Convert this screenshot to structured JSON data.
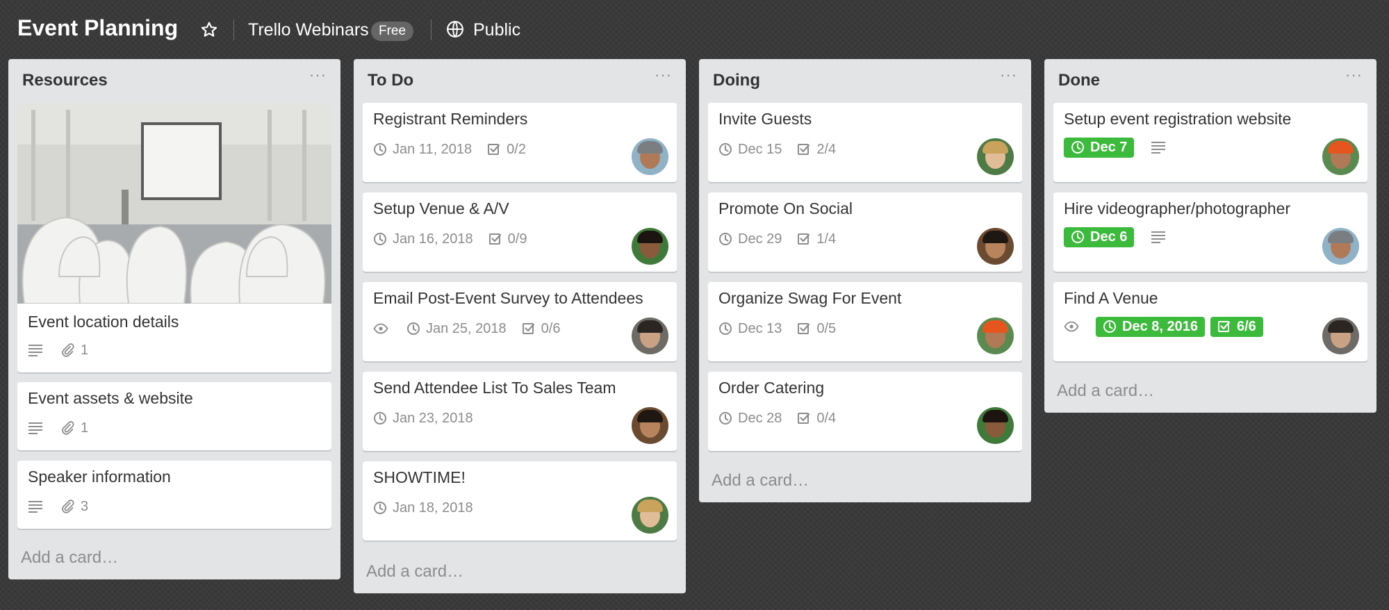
{
  "header": {
    "title": "Event Planning",
    "team": "Trello Webinars",
    "plan_badge": "Free",
    "visibility": "Public"
  },
  "colors": {
    "accent_green": "#3cba3c",
    "list_bg": "#e2e4e6"
  },
  "lists": [
    {
      "title": "Resources",
      "menu": "···",
      "add_card": "Add a card…",
      "cards": [
        {
          "title": "Event location details",
          "attachments": "1"
        },
        {
          "title": "Event assets & website",
          "attachments": "1"
        },
        {
          "title": "Speaker information",
          "attachments": "3"
        }
      ]
    },
    {
      "title": "To Do",
      "menu": "···",
      "add_card": "Add a card…",
      "cards": [
        {
          "title": "Registrant Reminders",
          "due": "Jan 11, 2018",
          "checklist": "0/2"
        },
        {
          "title": "Setup Venue & A/V",
          "due": "Jan 16, 2018",
          "checklist": "0/9"
        },
        {
          "title": "Email Post-Event Survey to Attendees",
          "due": "Jan 25, 2018",
          "checklist": "0/6"
        },
        {
          "title": "Send Attendee List To Sales Team",
          "due": "Jan 23, 2018"
        },
        {
          "title": "SHOWTIME!",
          "due": "Jan 18, 2018"
        }
      ]
    },
    {
      "title": "Doing",
      "menu": "···",
      "add_card": "Add a card…",
      "cards": [
        {
          "title": "Invite Guests",
          "due": "Dec 15",
          "checklist": "2/4"
        },
        {
          "title": "Promote On Social",
          "due": "Dec 29",
          "checklist": "1/4"
        },
        {
          "title": "Organize Swag For Event",
          "due": "Dec 13",
          "checklist": "0/5"
        },
        {
          "title": "Order Catering",
          "due": "Dec 28",
          "checklist": "0/4"
        }
      ]
    },
    {
      "title": "Done",
      "menu": "···",
      "add_card": "Add a card…",
      "cards": [
        {
          "title": "Setup event registration website",
          "due": "Dec 7"
        },
        {
          "title": "Hire videographer/photographer",
          "due": "Dec 6"
        },
        {
          "title": "Find A Venue",
          "due": "Dec 8, 2016",
          "checklist": "6/6"
        }
      ]
    }
  ]
}
